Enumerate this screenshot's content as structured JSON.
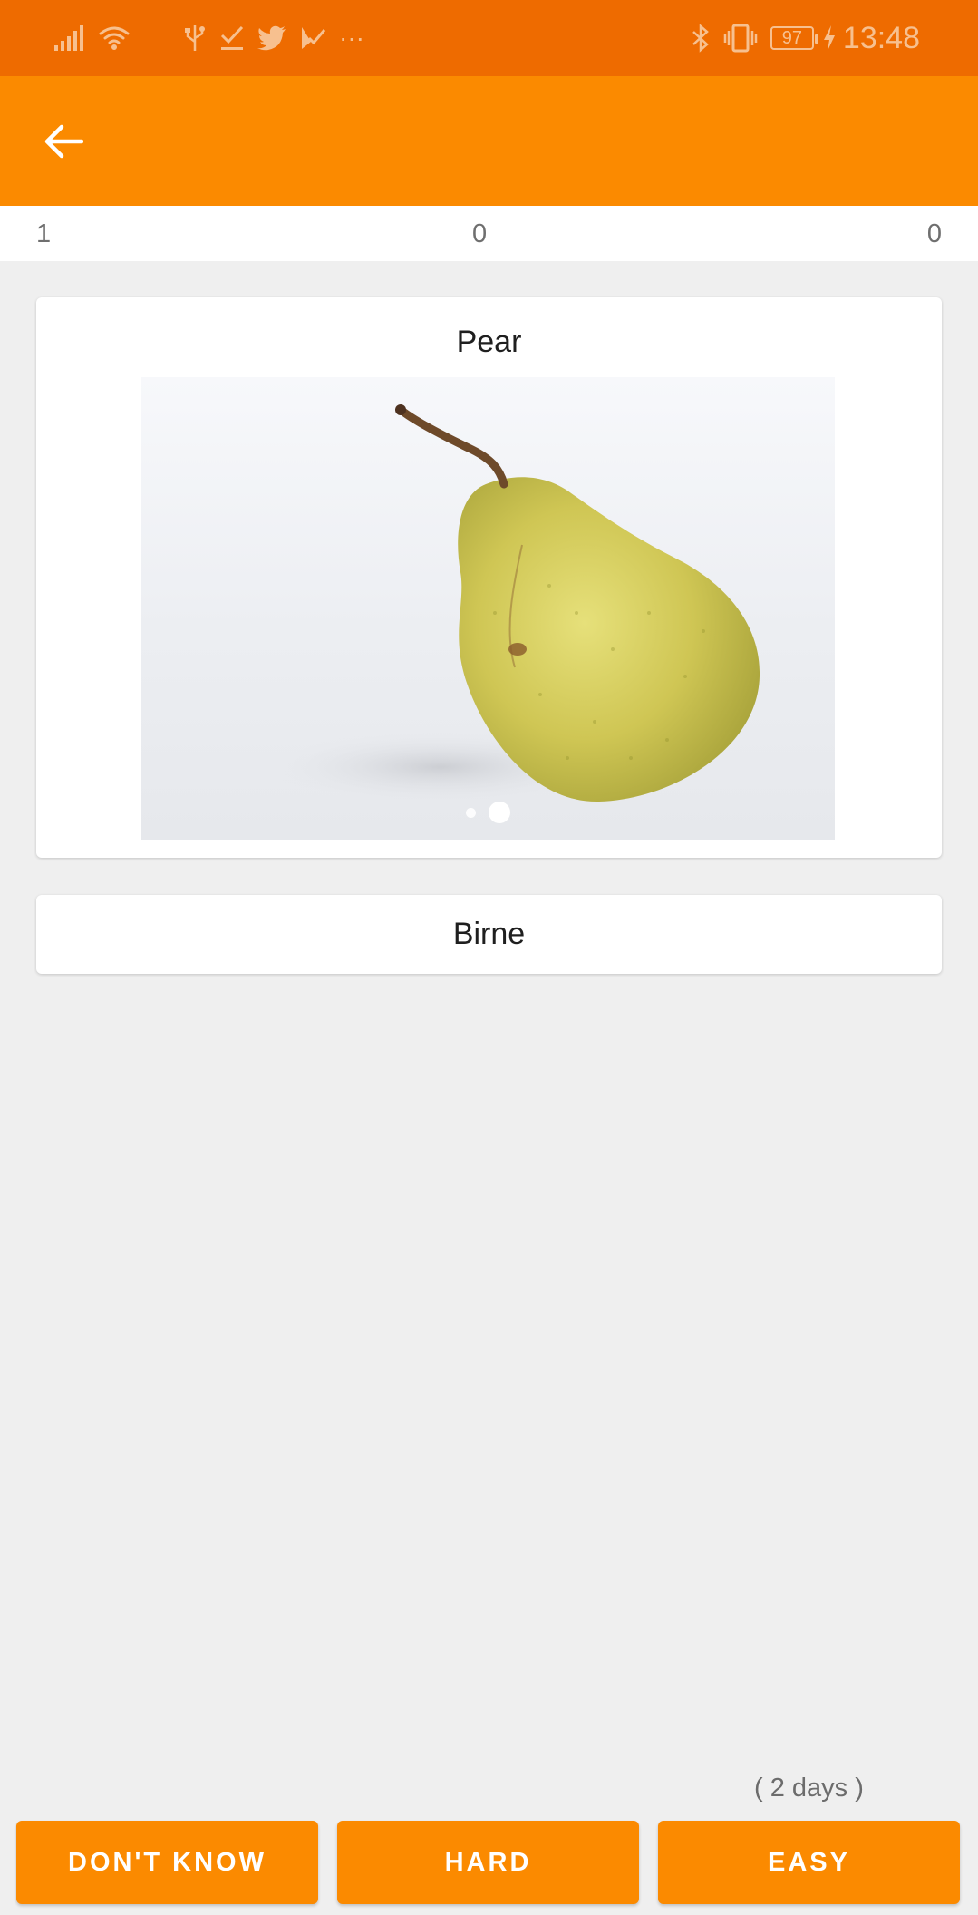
{
  "status_bar": {
    "time": "13:48",
    "battery": "97",
    "left_icons": [
      "signal-icon",
      "wifi-icon",
      "usb-icon",
      "task-check-icon",
      "twitter-icon",
      "flag-check-icon",
      "more-dots-icon"
    ],
    "right_icons": [
      "bluetooth-icon",
      "vibrate-icon",
      "battery-icon",
      "charging-icon"
    ],
    "more_label": "···"
  },
  "app_bar": {
    "back_icon": "arrow-left-icon",
    "color": "#fb8a00"
  },
  "counters": {
    "left": "1",
    "middle": "0",
    "right": "0"
  },
  "card_front": {
    "title": "Pear",
    "image": "pear-image",
    "carousel_page": 2,
    "carousel_total": 2
  },
  "card_back": {
    "title": "Birne"
  },
  "interval_label": "( 2 days )",
  "buttons": {
    "dont_know": "DON'T KNOW",
    "hard": "HARD",
    "easy": "EASY"
  },
  "colors": {
    "accent": "#fb8a00",
    "status_bar": "#ee6b00",
    "background": "#efefef"
  }
}
